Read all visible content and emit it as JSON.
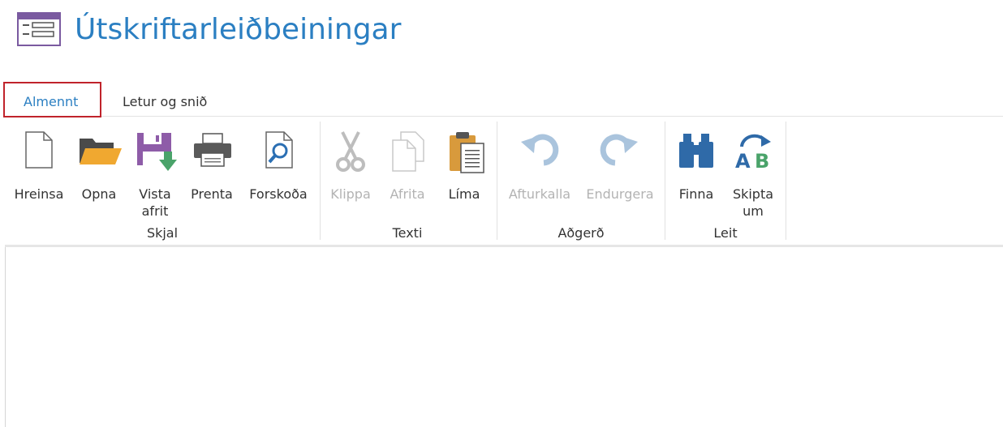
{
  "header": {
    "title": "Útskriftarleiðbeiningar",
    "icon": "form-window-icon"
  },
  "tabs": [
    {
      "label": "Almennt",
      "active": true
    },
    {
      "label": "Letur og snið",
      "active": false
    }
  ],
  "ribbon": {
    "groups": [
      {
        "label": "Skjal",
        "buttons": [
          {
            "label": "Hreinsa",
            "icon": "new-document-icon",
            "enabled": true
          },
          {
            "label": "Opna",
            "icon": "open-folder-icon",
            "enabled": true
          },
          {
            "label": "Vista\nafrit",
            "icon": "save-copy-icon",
            "enabled": true
          },
          {
            "label": "Prenta",
            "icon": "printer-icon",
            "enabled": true
          },
          {
            "label": "Forskoða",
            "icon": "print-preview-icon",
            "enabled": true
          }
        ]
      },
      {
        "label": "Texti",
        "buttons": [
          {
            "label": "Klippa",
            "icon": "scissors-icon",
            "enabled": false
          },
          {
            "label": "Afrita",
            "icon": "copy-icon",
            "enabled": false
          },
          {
            "label": "Líma",
            "icon": "paste-icon",
            "enabled": true
          }
        ]
      },
      {
        "label": "Aðgerð",
        "buttons": [
          {
            "label": "Afturkalla",
            "icon": "undo-icon",
            "enabled": false
          },
          {
            "label": "Endurgera",
            "icon": "redo-icon",
            "enabled": false
          }
        ]
      },
      {
        "label": "Leit",
        "buttons": [
          {
            "label": "Finna",
            "icon": "binoculars-icon",
            "enabled": true
          },
          {
            "label": "Skipta\num",
            "icon": "replace-icon",
            "enabled": true
          }
        ]
      }
    ]
  },
  "colors": {
    "accent": "#2b7fc2",
    "tab_highlight": "#c0232b",
    "disabled": "#b3b3b3"
  }
}
